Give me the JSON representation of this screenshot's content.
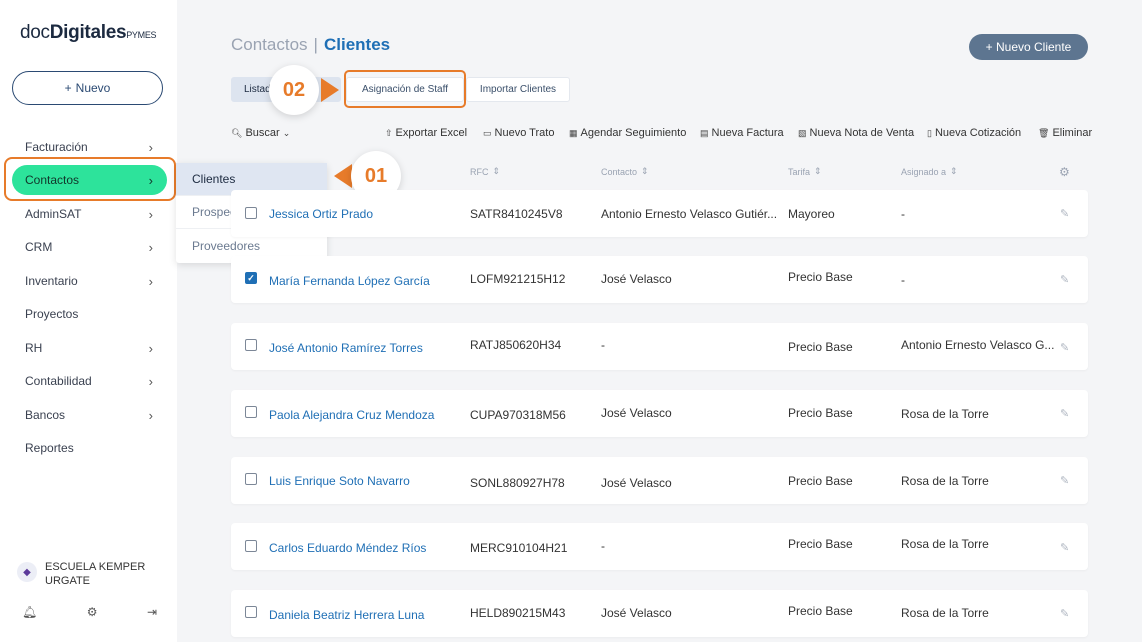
{
  "logo": {
    "part1": "doc",
    "part2": "Digitales",
    "part3": "PYMES"
  },
  "sidebar": {
    "new_button": {
      "icon": "+",
      "label": "Nuevo"
    },
    "items": [
      {
        "label": "Facturación",
        "chevron": "›"
      },
      {
        "label": "Contactos",
        "chevron": "›"
      },
      {
        "label": "AdminSAT",
        "chevron": "›"
      },
      {
        "label": "CRM",
        "chevron": "›"
      },
      {
        "label": "Inventario",
        "chevron": "›"
      },
      {
        "label": "Proyectos",
        "chevron": ""
      },
      {
        "label": "RH",
        "chevron": "›"
      },
      {
        "label": "Contabilidad",
        "chevron": "›"
      },
      {
        "label": "Bancos",
        "chevron": "›"
      },
      {
        "label": "Reportes",
        "chevron": ""
      }
    ],
    "org": {
      "name": "ESCUELA KEMPER URGATE"
    }
  },
  "submenu": {
    "items": [
      {
        "label": "Clientes"
      },
      {
        "label": "Prospectos"
      },
      {
        "label": "Proveedores"
      }
    ]
  },
  "callouts": {
    "one": "01",
    "two": "02"
  },
  "header": {
    "breadcrumb_parent": "Contactos",
    "breadcrumb_sep": "|",
    "breadcrumb_current": "Clientes",
    "new_client_button": "+ Nuevo Cliente"
  },
  "tabs": {
    "listado": "Listad",
    "staff": "Asignación de Staff",
    "importar": "Importar Clientes"
  },
  "toolbar": {
    "buscar": "Buscar",
    "exportar": "Exportar Excel",
    "trato": "Nuevo Trato",
    "seguimiento": "Agendar Seguimiento",
    "factura": "Nueva Factura",
    "nota": "Nueva Nota de Venta",
    "cotizacion": "Nueva Cotización",
    "eliminar": "Eliminar"
  },
  "columns": {
    "rfc": "RFC",
    "contacto": "Contacto",
    "tarifa": "Tarifa",
    "asignado": "Asignado a",
    "sort_glyph": "⇕"
  },
  "rows": [
    {
      "name": "Jessica Ortiz Prado",
      "rfc": "SATR8410245V8",
      "contacto": "Antonio Ernesto Velasco Gutiér...",
      "tarifa": "Mayoreo",
      "asignado": "-",
      "checked": false
    },
    {
      "name": "María Fernanda López García",
      "rfc": "LOFM921215H12",
      "contacto": "José Velasco",
      "tarifa": "Precio Base",
      "asignado": "-",
      "checked": true
    },
    {
      "name": "José Antonio Ramírez Torres",
      "rfc": "RATJ850620H34",
      "contacto": "-",
      "tarifa": "Precio Base",
      "asignado": "Antonio Ernesto Velasco G...",
      "checked": false
    },
    {
      "name": "Paola Alejandra Cruz Mendoza",
      "rfc": "CUPA970318M56",
      "contacto": "José Velasco",
      "tarifa": "Precio Base",
      "asignado": "Rosa de la Torre",
      "checked": false
    },
    {
      "name": "Luis Enrique Soto Navarro",
      "rfc": "SONL880927H78",
      "contacto": "José Velasco",
      "tarifa": "Precio Base",
      "asignado": "Rosa de la Torre",
      "checked": false
    },
    {
      "name": "Carlos Eduardo Méndez Ríos",
      "rfc": "MERC910104H21",
      "contacto": "-",
      "tarifa": "Precio Base",
      "asignado": "Rosa de la Torre",
      "checked": false
    },
    {
      "name": "Daniela Beatriz Herrera Luna",
      "rfc": "HELD890215M43",
      "contacto": "José Velasco",
      "tarifa": "Precio Base",
      "asignado": "Rosa de la Torre",
      "checked": false
    }
  ],
  "colors": {
    "accent_green": "#2de39b",
    "highlight_orange": "#e77b2a",
    "link_blue": "#1f6fb5",
    "button_slate": "#5d7590"
  }
}
